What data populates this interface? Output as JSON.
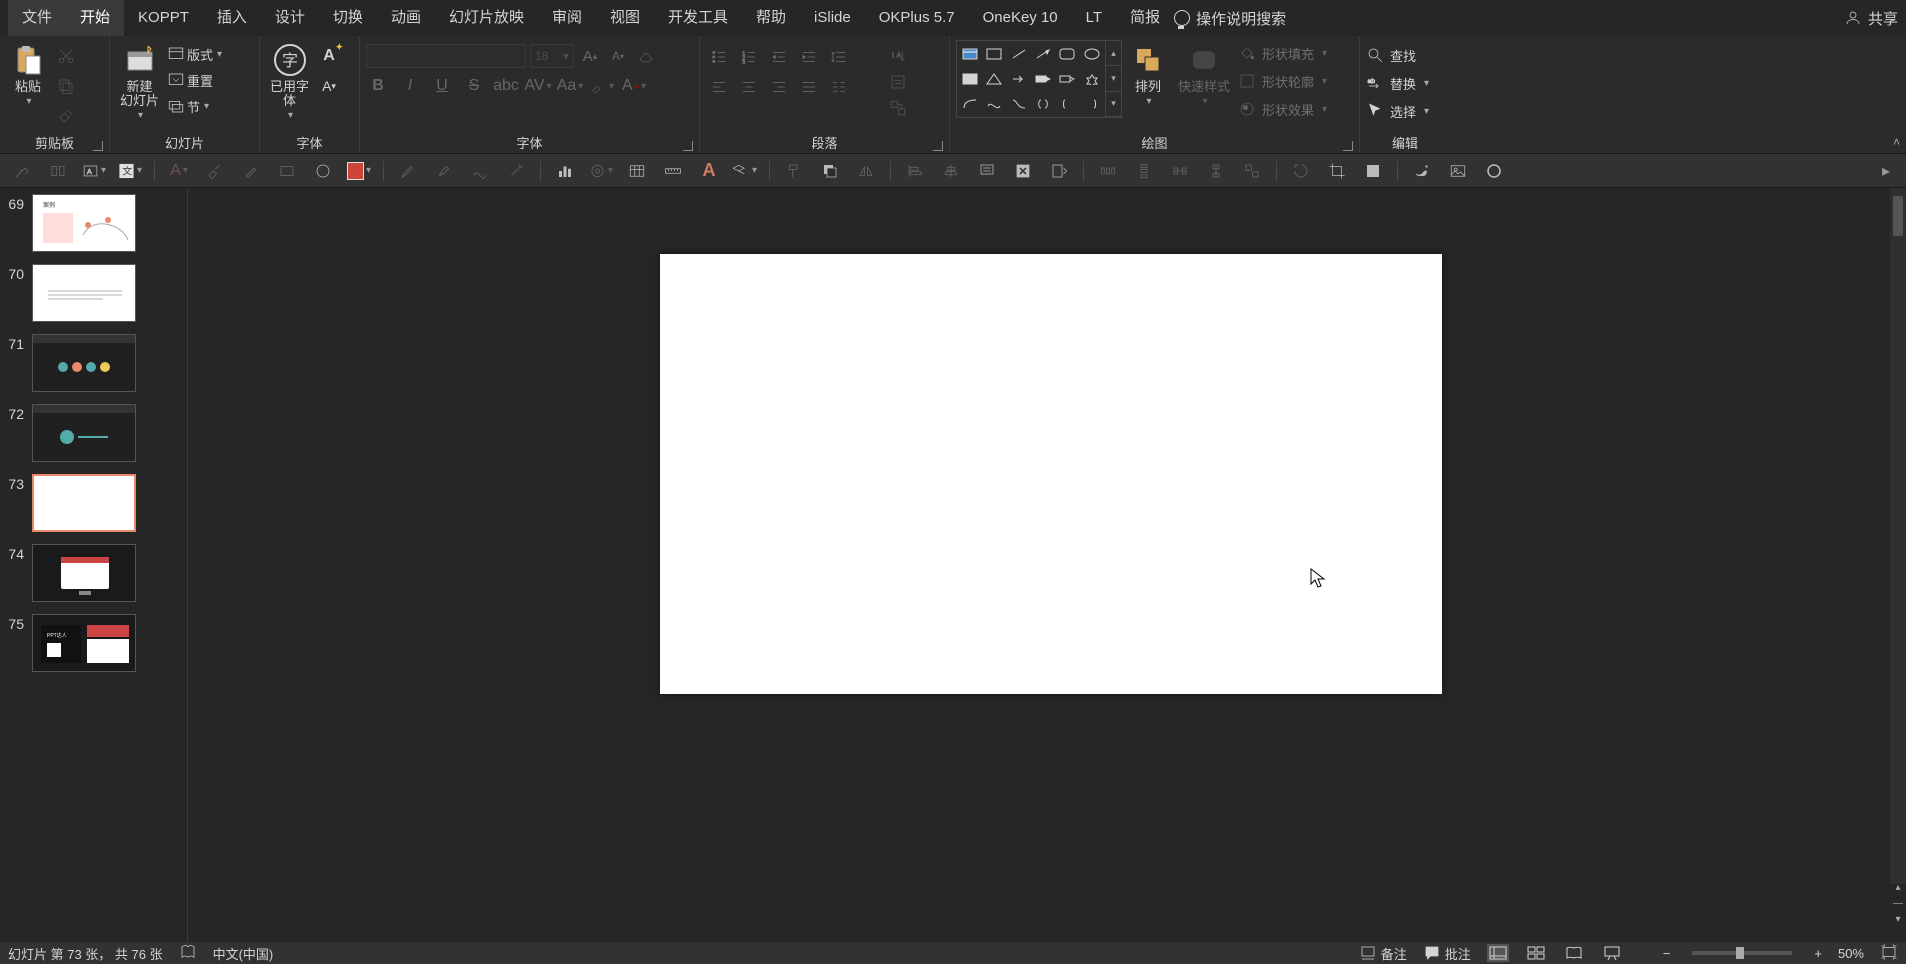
{
  "menu": {
    "file": "文件",
    "home": "开始",
    "koppt": "KOPPT",
    "insert": "插入",
    "design": "设计",
    "transitions": "切换",
    "animations": "动画",
    "slideshow": "幻灯片放映",
    "review": "审阅",
    "view": "视图",
    "developer": "开发工具",
    "help": "帮助",
    "islide": "iSlide",
    "okplus": "OKPlus 5.7",
    "onekey": "OneKey 10",
    "lt": "LT",
    "briefing": "简报",
    "tell_me": "操作说明搜索",
    "share": "共享"
  },
  "ribbon": {
    "clipboard": {
      "paste": "粘贴",
      "label": "剪贴板"
    },
    "slides": {
      "new_slide": "新建\n幻灯片",
      "layout": "版式",
      "reset": "重置",
      "section": "节",
      "label": "幻灯片"
    },
    "font": {
      "used_font": "已用字\n体",
      "size": "18",
      "label": "字体"
    },
    "paragraph": {
      "label": "段落"
    },
    "drawing": {
      "arrange": "排列",
      "quick_styles": "快速样式",
      "shape_fill": "形状填充",
      "shape_outline": "形状轮廓",
      "shape_effects": "形状效果",
      "label": "绘图"
    },
    "editing": {
      "find": "查找",
      "replace": "替换",
      "select": "选择",
      "label": "编辑"
    }
  },
  "thumbnails": [
    {
      "num": "69",
      "kind": "light-chart"
    },
    {
      "num": "70",
      "kind": "light-text"
    },
    {
      "num": "71",
      "kind": "darkui"
    },
    {
      "num": "72",
      "kind": "darkui"
    },
    {
      "num": "73",
      "kind": "blank",
      "selected": true
    },
    {
      "num": "74",
      "kind": "dark-browser"
    },
    {
      "num": "75",
      "kind": "dark-multi"
    }
  ],
  "status": {
    "slide_info": "幻灯片 第 73 张， 共 76 张",
    "language": "中文(中国)",
    "notes": "备注",
    "comments": "批注",
    "zoom": "50%"
  }
}
